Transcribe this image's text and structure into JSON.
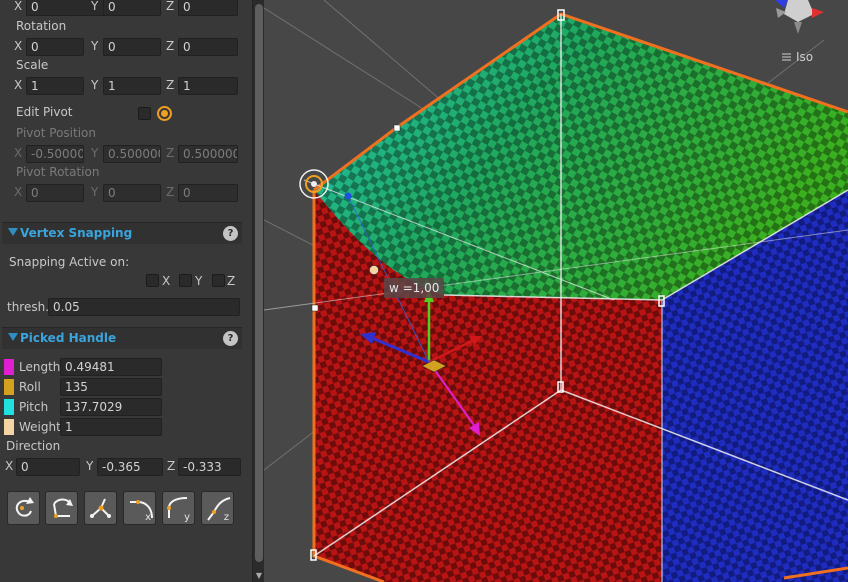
{
  "transform": {
    "position": {
      "x": "0",
      "y": "0",
      "z": "0"
    },
    "rotation_label": "Rotation",
    "rotation": {
      "x": "0",
      "y": "0",
      "z": "0"
    },
    "scale_label": "Scale",
    "scale": {
      "x": "1",
      "y": "1",
      "z": "1"
    },
    "edit_pivot_label": "Edit Pivot",
    "pivot_position_label": "Pivot Position",
    "pivot_position": {
      "x": "-0.50000",
      "y": "0.500000",
      "z": "0.500000"
    },
    "pivot_rotation_label": "Pivot Rotation",
    "pivot_rotation": {
      "x": "0",
      "y": "0",
      "z": "0"
    }
  },
  "axes": {
    "x": "X",
    "y": "Y",
    "z": "Z"
  },
  "vertex_snapping": {
    "title": "Vertex Snapping",
    "help": "?",
    "active_label": "Snapping Active on:",
    "thresh_label": "thresh.",
    "thresh_value": "0.05"
  },
  "picked_handle": {
    "title": "Picked Handle",
    "help": "?",
    "length_label": "Length",
    "length_value": "0.49481",
    "length_color": "#e020d0",
    "roll_label": "Roll",
    "roll_value": "135",
    "roll_color": "#d4a020",
    "pitch_label": "Pitch",
    "pitch_value": "137.7029",
    "pitch_color": "#20e0e0",
    "weight_label": "Weight",
    "weight_value": "1",
    "weight_color": "#f5d4a4",
    "direction_label": "Direction",
    "direction": {
      "x": "0",
      "y": "-0.365",
      "z": "-0.333"
    }
  },
  "tools": {
    "x_label": "x",
    "y_label": "y",
    "z_label": "z"
  },
  "viewport": {
    "iso_label": "Iso",
    "weight_label": "w =1,00"
  }
}
